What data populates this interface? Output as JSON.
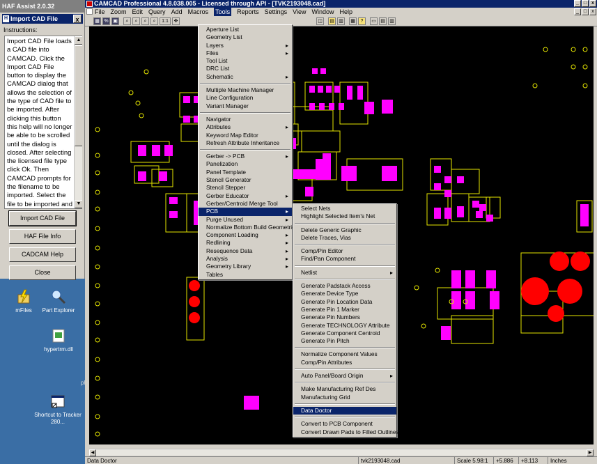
{
  "haf": {
    "title": "HAF Assist 2.0.32",
    "panel_title": "Import CAD File",
    "panel_icon_letter": "H",
    "close_glyph": "x",
    "instructions_label": "Instructions:",
    "instructions_text": "Import CAD File loads a CAD file into CAMCAD. Click the Import CAD File button to display the CAMCAD dialog that allows the selection of the type of CAD file to be imported. After clicking this button this help will no longer be able to be scrolled until the dialog is closed. After selecting the licensed file type click Ok. Then CAMCAD prompts for the filename to be imported. Select the file to be imported and click Open. To rotate the board to",
    "buttons": [
      "Import CAD File",
      "HAF File Info",
      "CADCAM Help",
      "Close"
    ]
  },
  "desktop": {
    "icons": [
      {
        "label": "mFiles",
        "icon": "lightning-folder-icon"
      },
      {
        "label": "Part Explorer",
        "icon": "part-explorer-icon"
      },
      {
        "label": "hypertrm.dll",
        "icon": "dll-file-icon"
      },
      {
        "label": "Shortcut to Tracker 280...",
        "icon": "shortcut-window-icon"
      }
    ],
    "partial_text": "ph"
  },
  "camcad": {
    "title": "CAMCAD Professional 4.8.038.005 - Licensed through API - [TVK2193048.cad]",
    "menu_bar": [
      "File",
      "Zoom",
      "Edit",
      "Query",
      "Add",
      "Macros",
      "Tools",
      "Reports",
      "Settings",
      "View",
      "Window",
      "Help"
    ],
    "active_menu": "Tools",
    "window_buttons": [
      "_",
      "□",
      "x"
    ],
    "toolbar_glyphs": [
      "▦",
      "%",
      "▣",
      "⌕",
      "⌕",
      "⌕",
      "⌕",
      "1:1",
      "✥"
    ],
    "toolbar_right_glyphs": [
      "◫",
      "▤",
      "▥",
      "▦",
      "?",
      "▭",
      "▤",
      "▥"
    ]
  },
  "tools_menu": {
    "groups": [
      [
        {
          "label": "Aperture List"
        },
        {
          "label": "Geometry List"
        },
        {
          "label": "Layers",
          "sub": true
        },
        {
          "label": "Files",
          "sub": true
        },
        {
          "label": "Tool List"
        },
        {
          "label": "DRC List"
        },
        {
          "label": "Schematic",
          "sub": true
        }
      ],
      [
        {
          "label": "Multiple Machine Manager"
        },
        {
          "label": "Line Configuration"
        },
        {
          "label": "Variant Manager"
        }
      ],
      [
        {
          "label": "Navigator"
        },
        {
          "label": "Attributes",
          "sub": true
        },
        {
          "label": "Keyword Map Editor"
        },
        {
          "label": "Refresh Attribute Inheritance"
        }
      ],
      [
        {
          "label": "Gerber -> PCB",
          "sub": true
        },
        {
          "label": "Panelization"
        },
        {
          "label": "Panel Template"
        },
        {
          "label": "Stencil Generator"
        },
        {
          "label": "Stencil Stepper"
        },
        {
          "label": "Gerber Educator",
          "sub": true
        },
        {
          "label": "Gerber/Centroid Merge Tool"
        },
        {
          "label": "PCB",
          "sub": true,
          "hl": true
        },
        {
          "label": "Purge Unused",
          "sub": true
        },
        {
          "label": "Normalize Bottom Build Geometries"
        },
        {
          "label": "Component Loading",
          "sub": true
        },
        {
          "label": "Redlining",
          "sub": true
        },
        {
          "label": "Resequence Data",
          "sub": true
        },
        {
          "label": "Analysis",
          "sub": true
        },
        {
          "label": "Geometry Library",
          "sub": true
        },
        {
          "label": "Tables"
        }
      ]
    ]
  },
  "pcb_menu": {
    "groups": [
      [
        {
          "label": "Select Nets"
        },
        {
          "label": "Highlight Selected Item's Net"
        }
      ],
      [
        {
          "label": "Delete Generic Graphic"
        },
        {
          "label": "Delete Traces, Vias"
        }
      ],
      [
        {
          "label": "Comp/Pin Editor"
        },
        {
          "label": "Find/Pan Component"
        }
      ],
      [
        {
          "label": "Netlist",
          "sub": true
        }
      ],
      [
        {
          "label": "Generate Padstack Access"
        },
        {
          "label": "Generate Device Type"
        },
        {
          "label": "Generate Pin Location Data"
        },
        {
          "label": "Generate Pin 1 Marker"
        },
        {
          "label": "Generate Pin Numbers"
        },
        {
          "label": "Generate TECHNOLOGY Attribute"
        },
        {
          "label": "Generate Component Centroid"
        },
        {
          "label": "Generate Pin Pitch"
        }
      ],
      [
        {
          "label": "Normalize Component Values"
        },
        {
          "label": "Comp/Pin Attributes"
        }
      ],
      [
        {
          "label": "Auto Panel/Board Origin",
          "sub": true
        }
      ],
      [
        {
          "label": "Make Manufacturing Ref Des"
        },
        {
          "label": "Manufacturing Grid"
        }
      ],
      [
        {
          "label": "Data Doctor",
          "hl": true
        }
      ],
      [
        {
          "label": "Convert to PCB Component"
        },
        {
          "label": "Convert Drawn Pads to Filled Outlines"
        }
      ]
    ]
  },
  "status": {
    "message": "Data Doctor",
    "file": "tvk2193048.cad",
    "scale": "Scale 5.98:1",
    "x": "+5.886",
    "y": "+8.113",
    "units": "Inches"
  },
  "colors": {
    "pad": "#ff00ff",
    "outline": "#e6e600",
    "hole": "#ff0000",
    "background": "#000000",
    "selection": "#0a246a"
  }
}
